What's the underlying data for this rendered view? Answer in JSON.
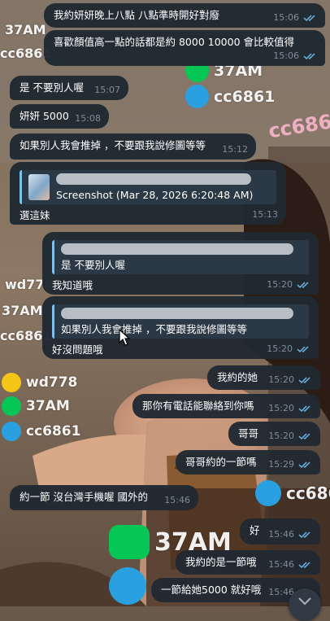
{
  "messages": [
    {
      "dir": "out",
      "text": "我約妍妍晚上八點 八點準時開好對廢",
      "time": "15:06",
      "read": true
    },
    {
      "dir": "out",
      "text": "喜歡顏值高一點的話都是約 8000 10000 會比較值得",
      "time": "15:06",
      "read": true
    },
    {
      "dir": "in",
      "text": "是 不要別人喔",
      "time": "15:07",
      "read": false
    },
    {
      "dir": "in",
      "text": "妍妍 5000",
      "time": "15:08",
      "read": false
    },
    {
      "dir": "in",
      "text": "如果別人我會推掉 ，不要跟我說修圖等等",
      "time": "15:12",
      "read": false
    },
    {
      "dir": "in",
      "text": "選這妹",
      "time": "15:13",
      "read": false,
      "reply": {
        "text": "Screenshot (Mar 28, 2026 6:20:48 AM)"
      }
    },
    {
      "dir": "out",
      "text": "我知道哦",
      "time": "15:20",
      "read": true,
      "reply": {
        "text": "是 不要別人喔"
      }
    },
    {
      "dir": "out",
      "text": "好沒問題哦",
      "time": "15:20",
      "read": true,
      "reply": {
        "text": "如果別人我會推掉 ，不要跟我說修圖等等"
      }
    },
    {
      "dir": "out",
      "text": "我約的她",
      "time": "15:20",
      "read": true
    },
    {
      "dir": "out",
      "text": "那你有電話能聯絡到你嗎",
      "time": "15:20",
      "read": true
    },
    {
      "dir": "out",
      "text": "哥哥",
      "time": "15:20",
      "read": true
    },
    {
      "dir": "out",
      "text": "哥哥約的一節嗎",
      "time": "15:29",
      "read": true
    },
    {
      "dir": "in",
      "text": "約一節 沒台灣手機喔 國外的",
      "time": "15:46",
      "read": false
    },
    {
      "dir": "out",
      "text": "好",
      "time": "15:46",
      "read": true
    },
    {
      "dir": "out",
      "text": "我約的是一節哦",
      "time": "15:46",
      "read": true
    },
    {
      "dir": "out",
      "text": "一節給她5000 就好哦",
      "time": "15:46",
      "read": true
    }
  ],
  "background": {
    "watermarks": {
      "wd": "wd778",
      "line_id": "37AM",
      "tg": "cc6861",
      "line_icon_text": "LINE",
      "wechat_icon_text": "wechat"
    }
  },
  "colors": {
    "bubble": "#212932",
    "meta": "#7f8d9b",
    "check": "#6fb6e6",
    "quote_bar": "#7fc0ea",
    "line_green": "#06c755",
    "telegram_blue": "#2aa0e0",
    "wechat_yellow": "#f5c518"
  }
}
